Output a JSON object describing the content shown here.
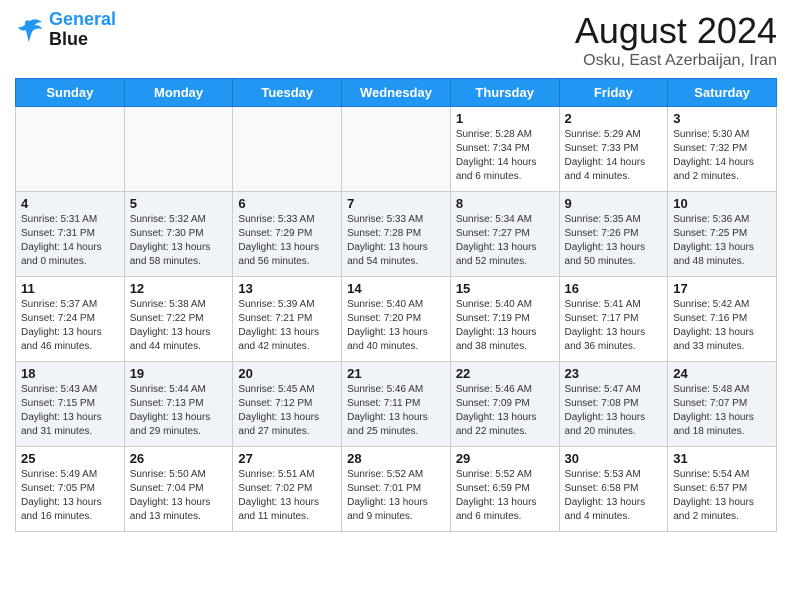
{
  "header": {
    "logo_line1": "General",
    "logo_line2": "Blue",
    "main_title": "August 2024",
    "subtitle": "Osku, East Azerbaijan, Iran"
  },
  "weekdays": [
    "Sunday",
    "Monday",
    "Tuesday",
    "Wednesday",
    "Thursday",
    "Friday",
    "Saturday"
  ],
  "weeks": [
    [
      {
        "day": "",
        "info": ""
      },
      {
        "day": "",
        "info": ""
      },
      {
        "day": "",
        "info": ""
      },
      {
        "day": "",
        "info": ""
      },
      {
        "day": "1",
        "info": "Sunrise: 5:28 AM\nSunset: 7:34 PM\nDaylight: 14 hours\nand 6 minutes."
      },
      {
        "day": "2",
        "info": "Sunrise: 5:29 AM\nSunset: 7:33 PM\nDaylight: 14 hours\nand 4 minutes."
      },
      {
        "day": "3",
        "info": "Sunrise: 5:30 AM\nSunset: 7:32 PM\nDaylight: 14 hours\nand 2 minutes."
      }
    ],
    [
      {
        "day": "4",
        "info": "Sunrise: 5:31 AM\nSunset: 7:31 PM\nDaylight: 14 hours\nand 0 minutes."
      },
      {
        "day": "5",
        "info": "Sunrise: 5:32 AM\nSunset: 7:30 PM\nDaylight: 13 hours\nand 58 minutes."
      },
      {
        "day": "6",
        "info": "Sunrise: 5:33 AM\nSunset: 7:29 PM\nDaylight: 13 hours\nand 56 minutes."
      },
      {
        "day": "7",
        "info": "Sunrise: 5:33 AM\nSunset: 7:28 PM\nDaylight: 13 hours\nand 54 minutes."
      },
      {
        "day": "8",
        "info": "Sunrise: 5:34 AM\nSunset: 7:27 PM\nDaylight: 13 hours\nand 52 minutes."
      },
      {
        "day": "9",
        "info": "Sunrise: 5:35 AM\nSunset: 7:26 PM\nDaylight: 13 hours\nand 50 minutes."
      },
      {
        "day": "10",
        "info": "Sunrise: 5:36 AM\nSunset: 7:25 PM\nDaylight: 13 hours\nand 48 minutes."
      }
    ],
    [
      {
        "day": "11",
        "info": "Sunrise: 5:37 AM\nSunset: 7:24 PM\nDaylight: 13 hours\nand 46 minutes."
      },
      {
        "day": "12",
        "info": "Sunrise: 5:38 AM\nSunset: 7:22 PM\nDaylight: 13 hours\nand 44 minutes."
      },
      {
        "day": "13",
        "info": "Sunrise: 5:39 AM\nSunset: 7:21 PM\nDaylight: 13 hours\nand 42 minutes."
      },
      {
        "day": "14",
        "info": "Sunrise: 5:40 AM\nSunset: 7:20 PM\nDaylight: 13 hours\nand 40 minutes."
      },
      {
        "day": "15",
        "info": "Sunrise: 5:40 AM\nSunset: 7:19 PM\nDaylight: 13 hours\nand 38 minutes."
      },
      {
        "day": "16",
        "info": "Sunrise: 5:41 AM\nSunset: 7:17 PM\nDaylight: 13 hours\nand 36 minutes."
      },
      {
        "day": "17",
        "info": "Sunrise: 5:42 AM\nSunset: 7:16 PM\nDaylight: 13 hours\nand 33 minutes."
      }
    ],
    [
      {
        "day": "18",
        "info": "Sunrise: 5:43 AM\nSunset: 7:15 PM\nDaylight: 13 hours\nand 31 minutes."
      },
      {
        "day": "19",
        "info": "Sunrise: 5:44 AM\nSunset: 7:13 PM\nDaylight: 13 hours\nand 29 minutes."
      },
      {
        "day": "20",
        "info": "Sunrise: 5:45 AM\nSunset: 7:12 PM\nDaylight: 13 hours\nand 27 minutes."
      },
      {
        "day": "21",
        "info": "Sunrise: 5:46 AM\nSunset: 7:11 PM\nDaylight: 13 hours\nand 25 minutes."
      },
      {
        "day": "22",
        "info": "Sunrise: 5:46 AM\nSunset: 7:09 PM\nDaylight: 13 hours\nand 22 minutes."
      },
      {
        "day": "23",
        "info": "Sunrise: 5:47 AM\nSunset: 7:08 PM\nDaylight: 13 hours\nand 20 minutes."
      },
      {
        "day": "24",
        "info": "Sunrise: 5:48 AM\nSunset: 7:07 PM\nDaylight: 13 hours\nand 18 minutes."
      }
    ],
    [
      {
        "day": "25",
        "info": "Sunrise: 5:49 AM\nSunset: 7:05 PM\nDaylight: 13 hours\nand 16 minutes."
      },
      {
        "day": "26",
        "info": "Sunrise: 5:50 AM\nSunset: 7:04 PM\nDaylight: 13 hours\nand 13 minutes."
      },
      {
        "day": "27",
        "info": "Sunrise: 5:51 AM\nSunset: 7:02 PM\nDaylight: 13 hours\nand 11 minutes."
      },
      {
        "day": "28",
        "info": "Sunrise: 5:52 AM\nSunset: 7:01 PM\nDaylight: 13 hours\nand 9 minutes."
      },
      {
        "day": "29",
        "info": "Sunrise: 5:52 AM\nSunset: 6:59 PM\nDaylight: 13 hours\nand 6 minutes."
      },
      {
        "day": "30",
        "info": "Sunrise: 5:53 AM\nSunset: 6:58 PM\nDaylight: 13 hours\nand 4 minutes."
      },
      {
        "day": "31",
        "info": "Sunrise: 5:54 AM\nSunset: 6:57 PM\nDaylight: 13 hours\nand 2 minutes."
      }
    ]
  ]
}
